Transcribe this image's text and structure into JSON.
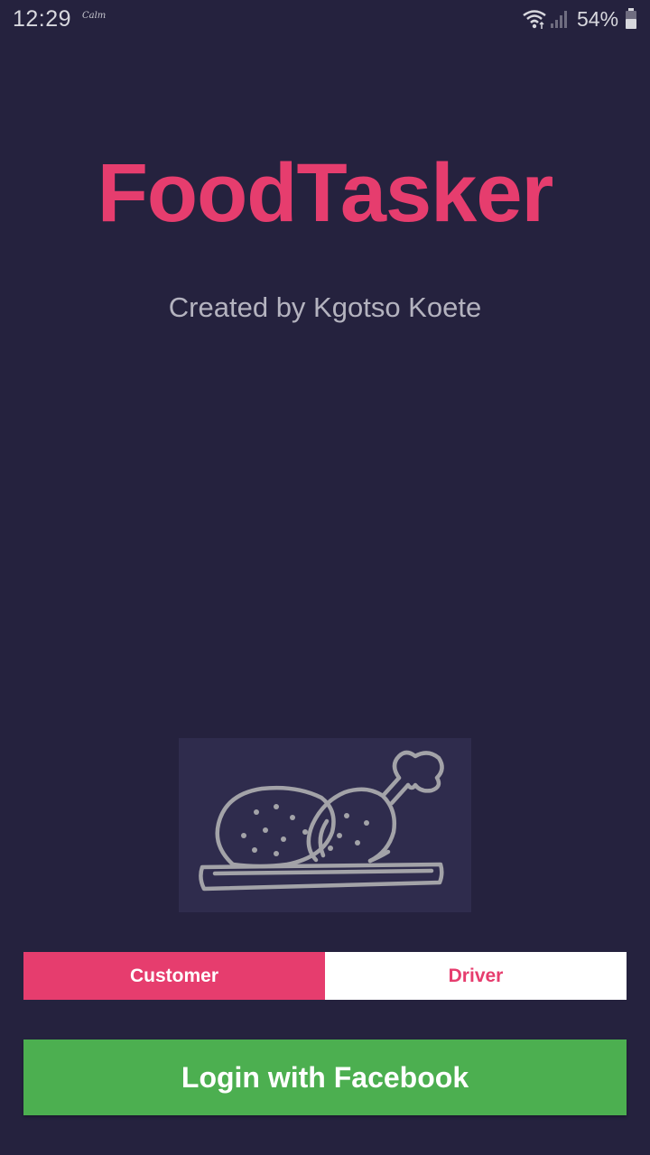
{
  "status_bar": {
    "time": "12:29",
    "notification_text": "Calm",
    "battery_percent": "54%",
    "icons": [
      "wifi-icon",
      "signal-icon",
      "battery-icon"
    ]
  },
  "app": {
    "title": "FoodTasker",
    "subtitle": "Created by Kgotso Koete"
  },
  "illustration": {
    "icon": "roast-chicken-icon"
  },
  "role_selector": {
    "options": [
      "Customer",
      "Driver"
    ],
    "selected": "Customer"
  },
  "login": {
    "button_label": "Login with Facebook"
  },
  "colors": {
    "background": "#25223e",
    "accent": "#e63d6e",
    "facebook_button": "#4caf50",
    "image_background": "#2f2c4d"
  }
}
